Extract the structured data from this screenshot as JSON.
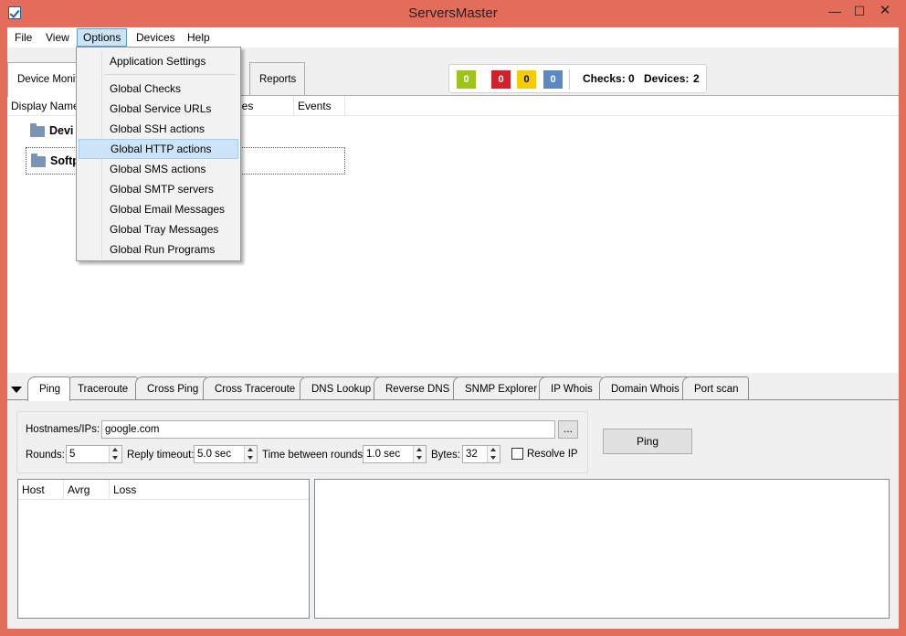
{
  "window": {
    "title": "ServersMaster"
  },
  "controls": {
    "minimize": "—",
    "maximize": "☐",
    "close": "✕"
  },
  "menu": [
    "File",
    "View",
    "Options",
    "Devices",
    "Help"
  ],
  "options_menu": {
    "items": [
      "Application Settings",
      "Global Checks",
      "Global Service URLs",
      "Global SSH actions",
      "Global HTTP actions",
      "Global SMS actions",
      "Global SMTP servers",
      "Global Email Messages",
      "Global Tray Messages",
      "Global Run Programs"
    ],
    "highlighted": "Global HTTP actions"
  },
  "top_tabs": [
    "Device Monito",
    "Reports"
  ],
  "status": {
    "badges": [
      {
        "value": "0",
        "color": "#9cc41a"
      },
      {
        "value": "0",
        "color": "#d42028"
      },
      {
        "value": "0",
        "color": "#f5cc00"
      },
      {
        "value": "0",
        "color": "#5b8ac2"
      }
    ],
    "checks_label": "Checks:",
    "checks_value": "0",
    "devices_label": "Devices:",
    "devices_value": "2"
  },
  "grid": {
    "columns": [
      "Display Name",
      "ues",
      "Events"
    ],
    "rows": [
      "Devi",
      "Softp"
    ]
  },
  "tool_tabs": [
    "Ping",
    "Traceroute",
    "Cross Ping",
    "Cross Traceroute",
    "DNS Lookup",
    "Reverse DNS",
    "SNMP Explorer",
    "IP Whois",
    "Domain Whois",
    "Port scan"
  ],
  "ping": {
    "hostnames_label": "Hostnames/IPs:",
    "hostnames_value": "google.com",
    "browse_label": "...",
    "rounds_label": "Rounds:",
    "rounds_value": "5",
    "reply_timeout_label": "Reply timeout:",
    "reply_timeout_value": "5.0 sec",
    "between_label": "Time between rounds:",
    "between_value": "1.0 sec",
    "bytes_label": "Bytes:",
    "bytes_value": "32",
    "resolve_label": "Resolve IP",
    "ping_button": "Ping"
  },
  "results": {
    "columns": [
      "Host",
      "Avrg",
      "Loss"
    ]
  }
}
